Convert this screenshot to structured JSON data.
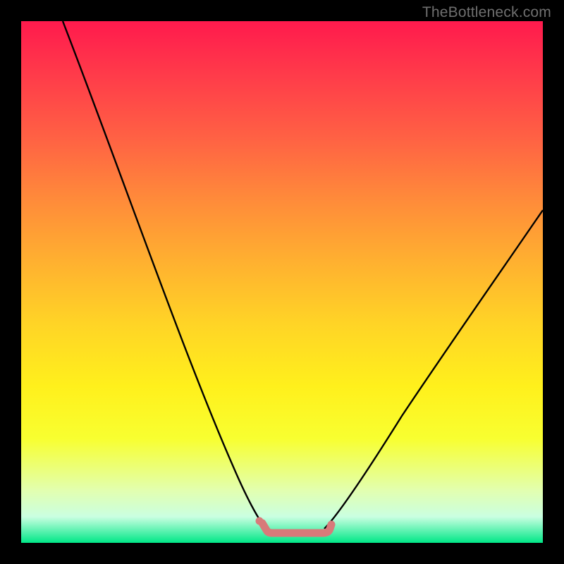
{
  "watermark": "TheBottleneck.com",
  "colors": {
    "page_bg": "#000000",
    "gradient_top": "#ff1a4d",
    "gradient_bottom": "#00e787",
    "curve_stroke": "#000000",
    "flat_stroke": "#d87a7a"
  },
  "chart_data": {
    "type": "line",
    "title": "",
    "xlabel": "",
    "ylabel": "",
    "xlim": [
      0,
      100
    ],
    "ylim": [
      0,
      100
    ],
    "grid": false,
    "note": "No axis ticks or numeric labels are rendered; values are estimated from pixel positions on a 0–100 normalized scale.",
    "series": [
      {
        "name": "left-curve",
        "x": [
          8,
          14,
          20,
          26,
          32,
          38,
          44,
          47
        ],
        "y": [
          100,
          83,
          67,
          51,
          36,
          22,
          9,
          4
        ]
      },
      {
        "name": "right-curve",
        "x": [
          58,
          62,
          68,
          74,
          80,
          86,
          92,
          100
        ],
        "y": [
          4,
          8,
          16,
          25,
          34,
          43,
          52,
          64
        ]
      },
      {
        "name": "bottom-flat",
        "x": [
          46,
          48,
          50,
          52,
          54,
          56,
          58,
          59
        ],
        "y": [
          4,
          3,
          3,
          3,
          3,
          3,
          3,
          4
        ]
      }
    ]
  }
}
